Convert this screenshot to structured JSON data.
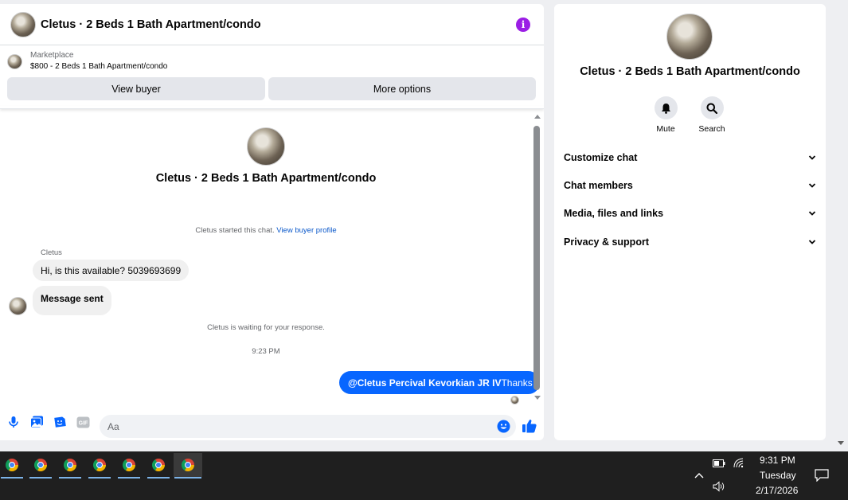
{
  "header": {
    "title": "Cletus · 2 Beds 1 Bath Apartment/condo",
    "info_icon": "info-icon"
  },
  "marketplace": {
    "label": "Marketplace",
    "listing": "$800 - 2 Beds 1 Bath Apartment/condo"
  },
  "actions": {
    "view_buyer": "View buyer",
    "more_options": "More options"
  },
  "conversation": {
    "profile_name": "Cletus · 2 Beds 1 Bath Apartment/condo",
    "started_text": "Cletus started this chat.",
    "view_profile_link": "View buyer profile",
    "sender_name": "Cletus",
    "messages": [
      {
        "from": "Cletus",
        "text": "Hi, is this available? 5039693699"
      },
      {
        "from": "Cletus",
        "text": "Message sent"
      }
    ],
    "waiting_text": "Cletus is waiting for your response.",
    "timestamp": "9:23 PM",
    "outgoing": {
      "mention": "@Cletus Percival Kevorkian JR IV",
      "text": "Thanks"
    }
  },
  "composer": {
    "placeholder": "Aa",
    "icons": [
      "microphone-icon",
      "image-icon",
      "sticker-icon",
      "gif-icon",
      "emoji-icon",
      "like-icon"
    ],
    "gif_label": "GIF"
  },
  "details_panel": {
    "name": "Cletus · 2 Beds 1 Bath Apartment/condo",
    "mute_label": "Mute",
    "search_label": "Search",
    "sections": [
      "Customize chat",
      "Chat members",
      "Media, files and links",
      "Privacy & support"
    ]
  },
  "taskbar": {
    "apps_count": 7,
    "time": "9:31 PM",
    "day": "Tuesday",
    "date": "2/17/2026"
  },
  "colors": {
    "accent_blue": "#0866ff",
    "info_purple": "#9b1ee5",
    "link_blue": "#0a58ca"
  }
}
